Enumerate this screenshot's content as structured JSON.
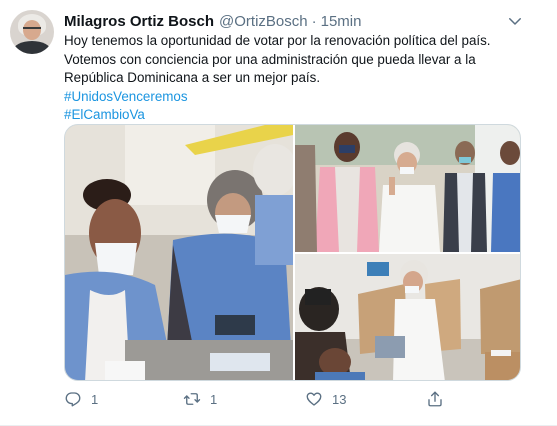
{
  "tweet": {
    "author_name": "Milagros Ortiz Bosch",
    "author_handle": "@OrtizBosch",
    "separator": "·",
    "time": "15min",
    "text_lines": [
      "Hoy tenemos la oportunidad de votar por la renovación política del país.",
      "Votemos con conciencia por una administración que pueda llevar a la",
      "República Dominicana a ser un mejor país."
    ],
    "hashtags": [
      "#UnidosVenceremos",
      "#ElCambioVa"
    ],
    "stats": {
      "replies": "1",
      "retweets": "1",
      "likes": "13"
    }
  },
  "icons": {
    "more": "chevron-down-icon",
    "reply": "reply-icon",
    "retweet": "retweet-icon",
    "like": "heart-icon",
    "share": "share-icon"
  },
  "colors": {
    "link": "#1b95e0",
    "secondary_text": "#5b7083",
    "primary_text": "#0f1419"
  }
}
